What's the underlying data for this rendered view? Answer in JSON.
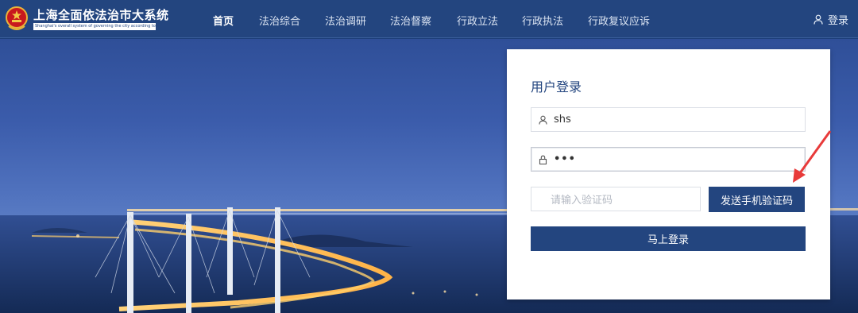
{
  "header": {
    "title": "上海全面依法治市大系统",
    "subtitle": "Shanghai's overall system of governing the city according to law",
    "nav": [
      "首页",
      "法治综合",
      "法治调研",
      "法治督察",
      "行政立法",
      "行政执法",
      "行政复议应诉"
    ],
    "active_nav": "首页",
    "login_label": "登录"
  },
  "login": {
    "title": "用户登录",
    "username_value": "shs",
    "password_value": "•••",
    "code_placeholder": "请输入验证码",
    "send_code_label": "发送手机验证码",
    "submit_label": "马上登录"
  },
  "colors": {
    "header_bg": "#23457f",
    "primary": "#23457f",
    "annotation_arrow": "#e83a3a"
  }
}
